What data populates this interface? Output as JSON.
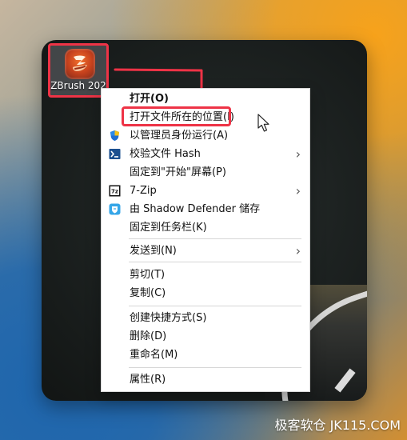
{
  "desktop": {
    "icon_label": "ZBrush 202",
    "icon_name": "zbrush-icon"
  },
  "context_menu": {
    "items": [
      {
        "label": "打开(O)",
        "icon": ""
      },
      {
        "label": "打开文件所在的位置(I)",
        "icon": ""
      },
      {
        "label": "以管理员身份运行(A)",
        "icon": "shield-icon"
      },
      {
        "label": "校验文件 Hash",
        "icon": "terminal-icon"
      },
      {
        "label": "固定到\"开始\"屏幕(P)",
        "icon": ""
      },
      {
        "label": "7-Zip",
        "icon": "7zip-icon"
      },
      {
        "label": "由 Shadow Defender 储存",
        "icon": "shadow-defender-icon"
      },
      {
        "label": "固定到任务栏(K)",
        "icon": ""
      },
      {
        "label": "发送到(N)",
        "icon": ""
      },
      {
        "label": "剪切(T)",
        "icon": ""
      },
      {
        "label": "复制(C)",
        "icon": ""
      },
      {
        "label": "创建快捷方式(S)",
        "icon": ""
      },
      {
        "label": "删除(D)",
        "icon": ""
      },
      {
        "label": "重命名(M)",
        "icon": ""
      },
      {
        "label": "属性(R)",
        "icon": ""
      }
    ]
  },
  "annotation": {
    "highlight_color": "#ee3346"
  },
  "watermark": {
    "text": "极客软仓 JK115.COM"
  }
}
